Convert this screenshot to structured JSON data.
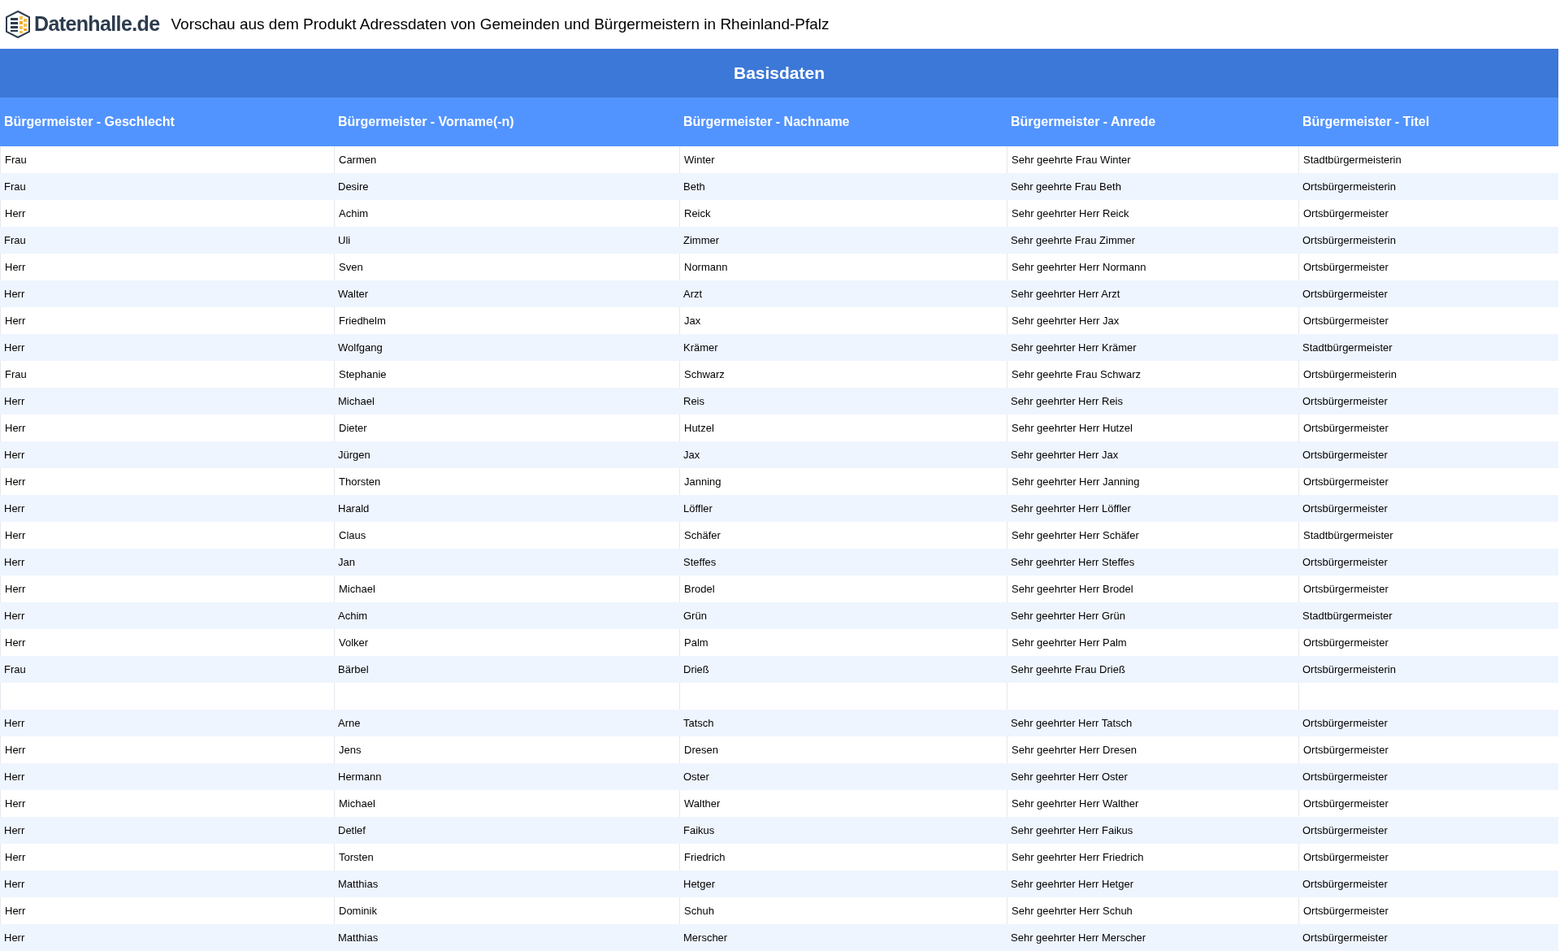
{
  "header": {
    "logo_text": "Datenhalle.de",
    "title": "Vorschau aus dem Produkt Adressdaten von Gemeinden und Bürgermeistern in Rheinland-Pfalz"
  },
  "section_title": "Basisdaten",
  "table": {
    "columns": [
      "Bürgermeister - Geschlecht",
      "Bürgermeister - Vorname(-n)",
      "Bürgermeister - Nachname",
      "Bürgermeister - Anrede",
      "Bürgermeister - Titel"
    ],
    "rows": [
      {
        "kind": "data",
        "cells": [
          "Frau",
          "Carmen",
          "Winter",
          "Sehr geehrte Frau Winter",
          "Stadtbürgermeisterin"
        ]
      },
      {
        "kind": "data",
        "cells": [
          "Frau",
          "Desire",
          "Beth",
          "Sehr geehrte Frau Beth",
          "Ortsbürgermeisterin"
        ]
      },
      {
        "kind": "data",
        "cells": [
          "Herr",
          "Achim",
          "Reick",
          "Sehr geehrter Herr Reick",
          "Ortsbürgermeister"
        ]
      },
      {
        "kind": "data",
        "cells": [
          "Frau",
          "Uli",
          "Zimmer",
          "Sehr geehrte Frau Zimmer",
          "Ortsbürgermeisterin"
        ]
      },
      {
        "kind": "data",
        "cells": [
          "Herr",
          "Sven",
          "Normann",
          "Sehr geehrter Herr Normann",
          "Ortsbürgermeister"
        ]
      },
      {
        "kind": "data",
        "cells": [
          "Herr",
          "Walter",
          "Arzt",
          "Sehr geehrter Herr Arzt",
          "Ortsbürgermeister"
        ]
      },
      {
        "kind": "data",
        "cells": [
          "Herr",
          "Friedhelm",
          "Jax",
          "Sehr geehrter Herr Jax",
          "Ortsbürgermeister"
        ]
      },
      {
        "kind": "data",
        "cells": [
          "Herr",
          "Wolfgang",
          "Krämer",
          "Sehr geehrter Herr Krämer",
          "Stadtbürgermeister"
        ]
      },
      {
        "kind": "data",
        "cells": [
          "Frau",
          "Stephanie",
          "Schwarz",
          "Sehr geehrte Frau Schwarz",
          "Ortsbürgermeisterin"
        ]
      },
      {
        "kind": "data",
        "cells": [
          "Herr",
          "Michael",
          "Reis",
          "Sehr geehrter Herr Reis",
          "Ortsbürgermeister"
        ]
      },
      {
        "kind": "data",
        "cells": [
          "Herr",
          "Dieter",
          "Hutzel",
          "Sehr geehrter Herr Hutzel",
          "Ortsbürgermeister"
        ]
      },
      {
        "kind": "data",
        "cells": [
          "Herr",
          "Jürgen",
          "Jax",
          "Sehr geehrter Herr Jax",
          "Ortsbürgermeister"
        ]
      },
      {
        "kind": "data",
        "cells": [
          "Herr",
          "Thorsten",
          "Janning",
          "Sehr geehrter Herr Janning",
          "Ortsbürgermeister"
        ]
      },
      {
        "kind": "data",
        "cells": [
          "Herr",
          "Harald",
          "Löffler",
          "Sehr geehrter Herr Löffler",
          "Ortsbürgermeister"
        ]
      },
      {
        "kind": "data",
        "cells": [
          "Herr",
          "Claus",
          "Schäfer",
          "Sehr geehrter Herr Schäfer",
          "Stadtbürgermeister"
        ]
      },
      {
        "kind": "data",
        "cells": [
          "Herr",
          "Jan",
          "Steffes",
          "Sehr geehrter Herr Steffes",
          "Ortsbürgermeister"
        ]
      },
      {
        "kind": "data",
        "cells": [
          "Herr",
          "Michael",
          "Brodel",
          "Sehr geehrter Herr Brodel",
          "Ortsbürgermeister"
        ]
      },
      {
        "kind": "data",
        "cells": [
          "Herr",
          "Achim",
          "Grün",
          "Sehr geehrter Herr Grün",
          "Stadtbürgermeister"
        ]
      },
      {
        "kind": "data",
        "cells": [
          "Herr",
          "Volker",
          "Palm",
          "Sehr geehrter Herr Palm",
          "Ortsbürgermeister"
        ]
      },
      {
        "kind": "data",
        "cells": [
          "Frau",
          "Bärbel",
          "Drieß",
          "Sehr geehrte Frau Drieß",
          "Ortsbürgermeisterin"
        ]
      },
      {
        "kind": "blank"
      },
      {
        "kind": "data",
        "cells": [
          "Herr",
          "Arne",
          "Tatsch",
          "Sehr geehrter Herr Tatsch",
          "Ortsbürgermeister"
        ]
      },
      {
        "kind": "data",
        "cells": [
          "Herr",
          "Jens",
          "Dresen",
          "Sehr geehrter Herr Dresen",
          "Ortsbürgermeister"
        ]
      },
      {
        "kind": "data",
        "cells": [
          "Herr",
          "Hermann",
          "Oster",
          "Sehr geehrter Herr Oster",
          "Ortsbürgermeister"
        ]
      },
      {
        "kind": "data",
        "cells": [
          "Herr",
          "Michael",
          "Walther",
          "Sehr geehrter Herr Walther",
          "Ortsbürgermeister"
        ]
      },
      {
        "kind": "data",
        "cells": [
          "Herr",
          "Detlef",
          "Faikus",
          "Sehr geehrter Herr Faikus",
          "Ortsbürgermeister"
        ]
      },
      {
        "kind": "data",
        "cells": [
          "Herr",
          "Torsten",
          "Friedrich",
          "Sehr geehrter Herr Friedrich",
          "Ortsbürgermeister"
        ]
      },
      {
        "kind": "data",
        "cells": [
          "Herr",
          "Matthias",
          "Hetger",
          "Sehr geehrter Herr Hetger",
          "Ortsbürgermeister"
        ]
      },
      {
        "kind": "data",
        "cells": [
          "Herr",
          "Dominik",
          "Schuh",
          "Sehr geehrter Herr Schuh",
          "Ortsbürgermeister"
        ]
      },
      {
        "kind": "data",
        "cells": [
          "Herr",
          "Matthias",
          "Merscher",
          "Sehr geehrter Herr Merscher",
          "Ortsbürgermeister"
        ]
      }
    ]
  }
}
